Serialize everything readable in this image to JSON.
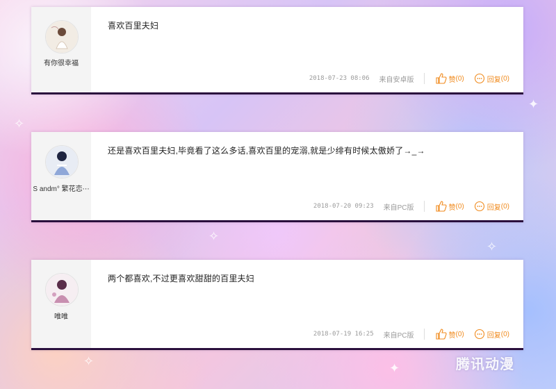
{
  "comments": [
    {
      "nickname": "有你很幸福",
      "content": "喜欢百里夫妇",
      "date": "2018-07-23 08:06",
      "source": "来自安卓版",
      "like_label": "赞",
      "like_count": "(0)",
      "reply_label": "回复",
      "reply_count": "(0)"
    },
    {
      "nickname": "S andm° 繁花恋⋯",
      "content": "还是喜欢百里夫妇,毕竟看了这么多话,喜欢百里的宠溺,就是少绯有时候太傲娇了→_→",
      "date": "2018-07-20 09:23",
      "source": "来自PC版",
      "like_label": "赞",
      "like_count": "(0)",
      "reply_label": "回复",
      "reply_count": "(0)"
    },
    {
      "nickname": "唯唯",
      "content": "两个都喜欢,不过更喜欢甜甜的百里夫妇",
      "date": "2018-07-19 16:25",
      "source": "来自PC版",
      "like_label": "赞",
      "like_count": "(0)",
      "reply_label": "回复",
      "reply_count": "(0)"
    }
  ],
  "watermark": "腾讯动漫",
  "colors": {
    "accent": "#f08a1c",
    "card_border": "#2a0f3d"
  }
}
